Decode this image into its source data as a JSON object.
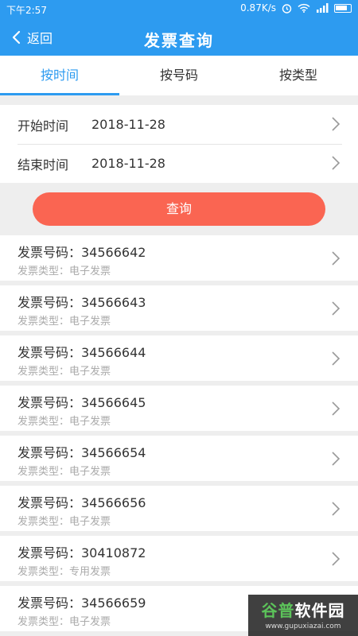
{
  "status": {
    "time": "下午2:57",
    "speed": "0.87K/s"
  },
  "header": {
    "back_label": "返回",
    "title": "发票查询"
  },
  "tabs": [
    {
      "label": "按时间",
      "active": true
    },
    {
      "label": "按号码",
      "active": false
    },
    {
      "label": "按类型",
      "active": false
    }
  ],
  "filter": {
    "start_label": "开始时间",
    "start_value": "2018-11-28",
    "end_label": "结束时间",
    "end_value": "2018-11-28"
  },
  "query_button": "查询",
  "invoices": [
    {
      "number": "发票号码：34566642",
      "type": "发票类型：电子发票"
    },
    {
      "number": "发票号码：34566643",
      "type": "发票类型：电子发票"
    },
    {
      "number": "发票号码：34566644",
      "type": "发票类型：电子发票"
    },
    {
      "number": "发票号码：34566645",
      "type": "发票类型：电子发票"
    },
    {
      "number": "发票号码：34566654",
      "type": "发票类型：电子发票"
    },
    {
      "number": "发票号码：34566656",
      "type": "发票类型：电子发票"
    },
    {
      "number": "发票号码：30410872",
      "type": "发票类型：专用发票"
    },
    {
      "number": "发票号码：34566659",
      "type": "发票类型：电子发票"
    }
  ],
  "watermark": {
    "brand_green": "谷普",
    "brand_white": "软件园",
    "url": "www.gupuxiazai.com"
  },
  "colors": {
    "primary": "#2d9bf0",
    "button": "#fa6552"
  }
}
